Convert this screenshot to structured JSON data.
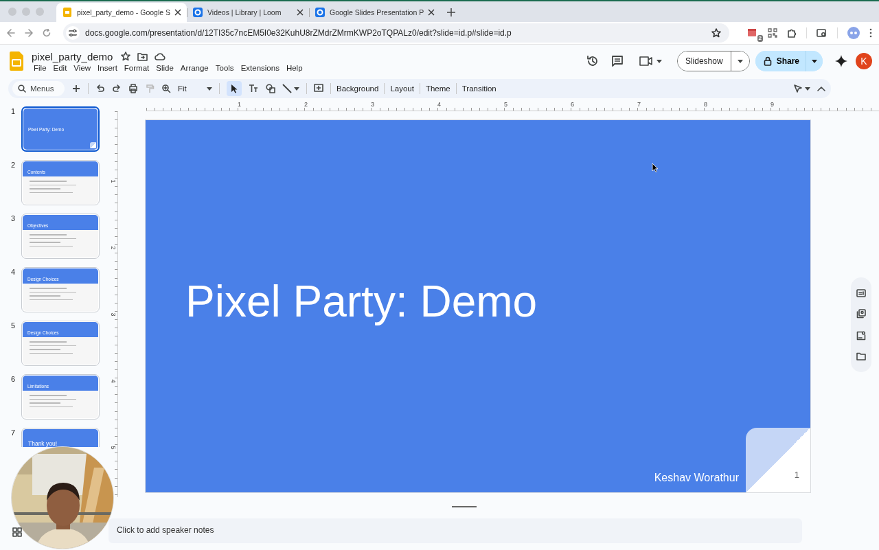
{
  "browser": {
    "tabs": [
      {
        "title": "pixel_party_demo - Google S",
        "selected": true
      },
      {
        "title": "Videos | Library | Loom",
        "selected": false
      },
      {
        "title": "Google Slides Presentation P",
        "selected": false
      }
    ],
    "url": "docs.google.com/presentation/d/12TI35c7ncEM5I0e32KuhU8rZMdrZMrmKWP2oTQPALz0/edit?slide=id.p#slide=id.p",
    "extension_badge": "2"
  },
  "document": {
    "title": "pixel_party_demo",
    "menu": [
      "File",
      "Edit",
      "View",
      "Insert",
      "Format",
      "Slide",
      "Arrange",
      "Tools",
      "Extensions",
      "Help"
    ],
    "slideshow_button": "Slideshow",
    "share_button": "Share",
    "avatar": "K"
  },
  "toolbar": {
    "search_placeholder": "Menus",
    "zoom": "Fit",
    "select_tool_selected": true,
    "buttons": [
      "Background",
      "Layout",
      "Theme",
      "Transition"
    ]
  },
  "ruler": {
    "horizontal": [
      "1",
      "2",
      "3",
      "4",
      "5",
      "6",
      "7",
      "8",
      "9"
    ],
    "vertical": [
      "1",
      "2",
      "3",
      "4",
      "5"
    ]
  },
  "slides": [
    {
      "number": "1",
      "title": "Pixel Party: Demo",
      "kind": "title",
      "selected": true
    },
    {
      "number": "2",
      "title": "Contents",
      "kind": "content",
      "selected": false
    },
    {
      "number": "3",
      "title": "Objectives",
      "kind": "content",
      "selected": false
    },
    {
      "number": "4",
      "title": "Design Choices",
      "kind": "content",
      "selected": false
    },
    {
      "number": "5",
      "title": "Design Choices",
      "kind": "content",
      "selected": false
    },
    {
      "number": "6",
      "title": "Limitations",
      "kind": "content",
      "selected": false
    },
    {
      "number": "7",
      "title": "Thank you!",
      "kind": "closing",
      "selected": false
    }
  ],
  "canvas": {
    "title": "Pixel Party: Demo",
    "author": "Keshav Worathur",
    "page_number": "1"
  },
  "notes": {
    "placeholder": "Click to add speaker notes"
  }
}
